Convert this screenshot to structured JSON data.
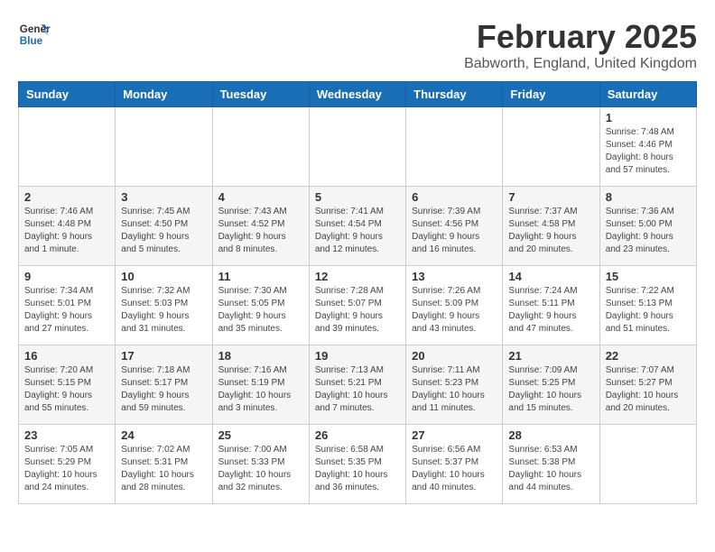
{
  "header": {
    "logo_line1": "General",
    "logo_line2": "Blue",
    "title": "February 2025",
    "location": "Babworth, England, United Kingdom"
  },
  "days_of_week": [
    "Sunday",
    "Monday",
    "Tuesday",
    "Wednesday",
    "Thursday",
    "Friday",
    "Saturday"
  ],
  "weeks": [
    [
      {
        "day": "",
        "info": ""
      },
      {
        "day": "",
        "info": ""
      },
      {
        "day": "",
        "info": ""
      },
      {
        "day": "",
        "info": ""
      },
      {
        "day": "",
        "info": ""
      },
      {
        "day": "",
        "info": ""
      },
      {
        "day": "1",
        "info": "Sunrise: 7:48 AM\nSunset: 4:46 PM\nDaylight: 8 hours and 57 minutes."
      }
    ],
    [
      {
        "day": "2",
        "info": "Sunrise: 7:46 AM\nSunset: 4:48 PM\nDaylight: 9 hours and 1 minute."
      },
      {
        "day": "3",
        "info": "Sunrise: 7:45 AM\nSunset: 4:50 PM\nDaylight: 9 hours and 5 minutes."
      },
      {
        "day": "4",
        "info": "Sunrise: 7:43 AM\nSunset: 4:52 PM\nDaylight: 9 hours and 8 minutes."
      },
      {
        "day": "5",
        "info": "Sunrise: 7:41 AM\nSunset: 4:54 PM\nDaylight: 9 hours and 12 minutes."
      },
      {
        "day": "6",
        "info": "Sunrise: 7:39 AM\nSunset: 4:56 PM\nDaylight: 9 hours and 16 minutes."
      },
      {
        "day": "7",
        "info": "Sunrise: 7:37 AM\nSunset: 4:58 PM\nDaylight: 9 hours and 20 minutes."
      },
      {
        "day": "8",
        "info": "Sunrise: 7:36 AM\nSunset: 5:00 PM\nDaylight: 9 hours and 23 minutes."
      }
    ],
    [
      {
        "day": "9",
        "info": "Sunrise: 7:34 AM\nSunset: 5:01 PM\nDaylight: 9 hours and 27 minutes."
      },
      {
        "day": "10",
        "info": "Sunrise: 7:32 AM\nSunset: 5:03 PM\nDaylight: 9 hours and 31 minutes."
      },
      {
        "day": "11",
        "info": "Sunrise: 7:30 AM\nSunset: 5:05 PM\nDaylight: 9 hours and 35 minutes."
      },
      {
        "day": "12",
        "info": "Sunrise: 7:28 AM\nSunset: 5:07 PM\nDaylight: 9 hours and 39 minutes."
      },
      {
        "day": "13",
        "info": "Sunrise: 7:26 AM\nSunset: 5:09 PM\nDaylight: 9 hours and 43 minutes."
      },
      {
        "day": "14",
        "info": "Sunrise: 7:24 AM\nSunset: 5:11 PM\nDaylight: 9 hours and 47 minutes."
      },
      {
        "day": "15",
        "info": "Sunrise: 7:22 AM\nSunset: 5:13 PM\nDaylight: 9 hours and 51 minutes."
      }
    ],
    [
      {
        "day": "16",
        "info": "Sunrise: 7:20 AM\nSunset: 5:15 PM\nDaylight: 9 hours and 55 minutes."
      },
      {
        "day": "17",
        "info": "Sunrise: 7:18 AM\nSunset: 5:17 PM\nDaylight: 9 hours and 59 minutes."
      },
      {
        "day": "18",
        "info": "Sunrise: 7:16 AM\nSunset: 5:19 PM\nDaylight: 10 hours and 3 minutes."
      },
      {
        "day": "19",
        "info": "Sunrise: 7:13 AM\nSunset: 5:21 PM\nDaylight: 10 hours and 7 minutes."
      },
      {
        "day": "20",
        "info": "Sunrise: 7:11 AM\nSunset: 5:23 PM\nDaylight: 10 hours and 11 minutes."
      },
      {
        "day": "21",
        "info": "Sunrise: 7:09 AM\nSunset: 5:25 PM\nDaylight: 10 hours and 15 minutes."
      },
      {
        "day": "22",
        "info": "Sunrise: 7:07 AM\nSunset: 5:27 PM\nDaylight: 10 hours and 20 minutes."
      }
    ],
    [
      {
        "day": "23",
        "info": "Sunrise: 7:05 AM\nSunset: 5:29 PM\nDaylight: 10 hours and 24 minutes."
      },
      {
        "day": "24",
        "info": "Sunrise: 7:02 AM\nSunset: 5:31 PM\nDaylight: 10 hours and 28 minutes."
      },
      {
        "day": "25",
        "info": "Sunrise: 7:00 AM\nSunset: 5:33 PM\nDaylight: 10 hours and 32 minutes."
      },
      {
        "day": "26",
        "info": "Sunrise: 6:58 AM\nSunset: 5:35 PM\nDaylight: 10 hours and 36 minutes."
      },
      {
        "day": "27",
        "info": "Sunrise: 6:56 AM\nSunset: 5:37 PM\nDaylight: 10 hours and 40 minutes."
      },
      {
        "day": "28",
        "info": "Sunrise: 6:53 AM\nSunset: 5:38 PM\nDaylight: 10 hours and 44 minutes."
      },
      {
        "day": "",
        "info": ""
      }
    ]
  ]
}
